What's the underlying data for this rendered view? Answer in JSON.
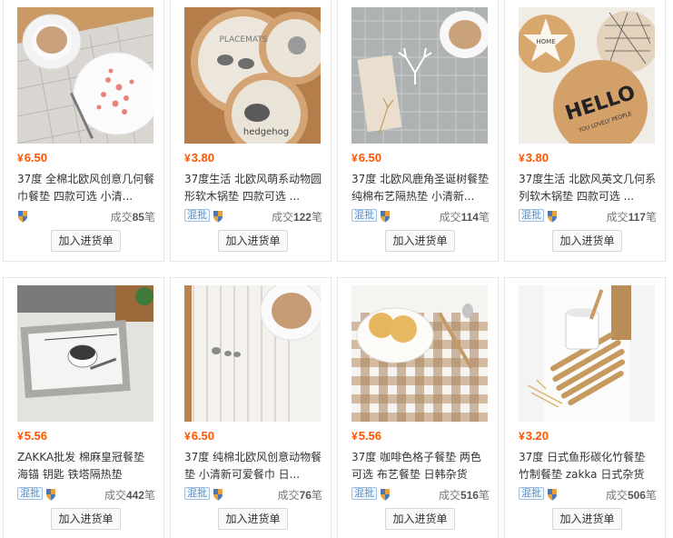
{
  "currency_symbol": "¥",
  "add_button_label": "加入进货单",
  "mix_badge_label": "混批",
  "deal_prefix": "成交",
  "deal_suffix": "笔",
  "colors": {
    "price": "#ff5500",
    "badge": "#5a8fc4"
  },
  "products": [
    {
      "price": "6.50",
      "title": "37度 全棉北欧风创意几何餐巾餐垫 四款可选 小清...",
      "mix": false,
      "deals": "85",
      "image": "geometric-placemat-with-cup"
    },
    {
      "price": "3.80",
      "title": "37度生活 北欧风萌系动物圆形软木锅垫 四款可选 ...",
      "mix": true,
      "deals": "122",
      "image": "cork-animal-placemats"
    },
    {
      "price": "6.50",
      "title": "37度 北欧风鹿角圣诞树餐垫纯棉布艺隔热垫 小清新...",
      "mix": true,
      "deals": "114",
      "image": "antler-grid-placemat"
    },
    {
      "price": "3.80",
      "title": "37度生活 北欧风英文几何系列软木锅垫 四款可选 ...",
      "mix": true,
      "deals": "117",
      "image": "cork-hello-coasters"
    },
    {
      "price": "5.56",
      "title": "ZAKKA批发 棉麻皇冠餐垫 海锚 钥匙 铁塔隔热垫",
      "mix": true,
      "deals": "442",
      "image": "linen-placemat-with-bowl"
    },
    {
      "price": "6.50",
      "title": "37度 纯棉北欧风创意动物餐垫 小清新可爱餐巾 日...",
      "mix": true,
      "deals": "76",
      "image": "striped-placemat-with-cup"
    },
    {
      "price": "5.56",
      "title": "37度 咖啡色格子餐垫 两色可选 布艺餐垫 日韩杂货",
      "mix": true,
      "deals": "516",
      "image": "gingham-placemat-with-bread"
    },
    {
      "price": "3.20",
      "title": "37度 日式鱼形碳化竹餐垫 竹制餐垫 zakka 日式杂货",
      "mix": true,
      "deals": "506",
      "image": "bamboo-fish-mat-with-mug"
    }
  ]
}
